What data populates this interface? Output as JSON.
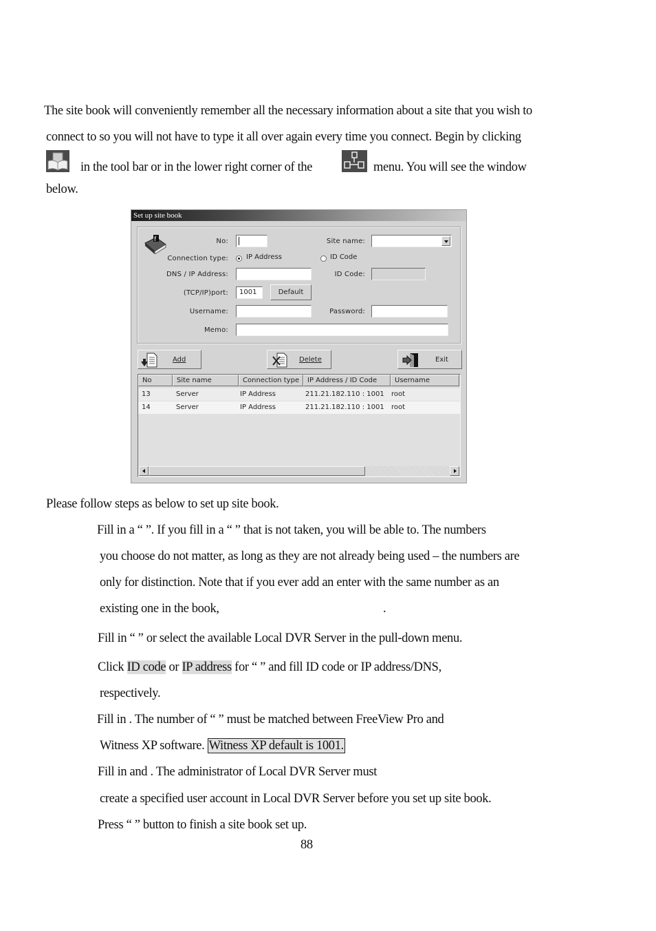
{
  "intro": {
    "line1": "The site book will conveniently remember all the necessary information about a site that you wish to",
    "line2": "connect to so you will not have to type it all over again every time you connect.    Begin by clicking",
    "line3a": "in the tool bar or in the lower right corner of the",
    "line3b": "menu.    You will see the window",
    "line4": "below.",
    "icon1": "site-book-icon",
    "icon2": "network-icon"
  },
  "dialog": {
    "title": "Set up site book",
    "labels": {
      "no": "No:",
      "site_name": "Site name:",
      "connection_type": "Connection type:",
      "dns_ip": "DNS / IP Address:",
      "id_code": "ID Code:",
      "port": "(TCP/IP)port:",
      "username": "Username:",
      "password": "Password:",
      "memo": "Memo:"
    },
    "fields": {
      "no": "",
      "site_name": "",
      "dns_ip": "",
      "id_code": "",
      "port": "1001",
      "username": "",
      "password": "",
      "memo": ""
    },
    "radios": [
      {
        "label": "IP Address",
        "selected": true
      },
      {
        "label": "ID Code",
        "selected": false
      }
    ],
    "buttons": {
      "default": "Default",
      "add": "Add",
      "delete": "Delete",
      "exit": "Exit"
    },
    "table": {
      "columns": [
        "No",
        "Site name",
        "Connection type",
        "IP Address / ID Code",
        "Username"
      ],
      "rows": [
        [
          "13",
          "Server",
          "IP Address",
          "211.21.182.110 : 1001",
          "root"
        ],
        [
          "14",
          "Server",
          "IP Address",
          "211.21.182.110 : 1001",
          "root"
        ]
      ]
    }
  },
  "steps": {
    "intro": "Please follow steps as below to set up site book.",
    "s1_l1": "Fill in a “     ”.    If you fill in a “     ” that is not taken, you will be able to.    The numbers",
    "s1_l2": "you choose do not matter, as long as they are not already being used – the numbers are",
    "s1_l3": "only for distinction.    Note that if you ever add an enter with the same number as an",
    "s1_l4a": "existing one in the book,",
    "s1_l4b": ".",
    "s2": "Fill in “                  ” or select the available Local DVR Server in the pull-down menu.",
    "s3_pre": "Click ",
    "s3_hl1": "ID code",
    "s3_mid": " or ",
    "s3_hl2": "IP address",
    "s3_post": " for “                              ” and fill ID code or IP address/DNS,",
    "s3_l2": "respectively.",
    "s4_l1": "Fill in             .    The number of “        ” must be matched between FreeView Pro and",
    "s4_l2a": "Witness XP software. ",
    "s4_l2b": "Witness XP default is 1001.",
    "s5_l1": "Fill in                        and                      .    The administrator of Local DVR Server must",
    "s5_l2": "create a specified user account in Local DVR Server before you set up site book.",
    "s6": "Press “       ” button to finish a site book set up."
  },
  "page_number": "88"
}
